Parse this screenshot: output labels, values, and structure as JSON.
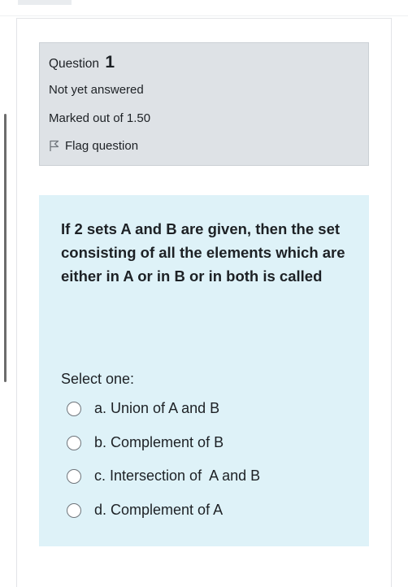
{
  "question": {
    "label": "Question",
    "number": "1",
    "state": "Not yet answered",
    "grade": "Marked out of 1.50",
    "flag_label": "Flag question",
    "text": "If 2 sets A and B are given, then the set consisting of all the elements which are either in A or in B or in both is called",
    "prompt": "Select one:",
    "options": [
      {
        "label": "a. Union of A and B"
      },
      {
        "label": "b. Complement of B"
      },
      {
        "label": "c. Intersection of  A and B"
      },
      {
        "label": "d. Complement of A"
      }
    ]
  }
}
